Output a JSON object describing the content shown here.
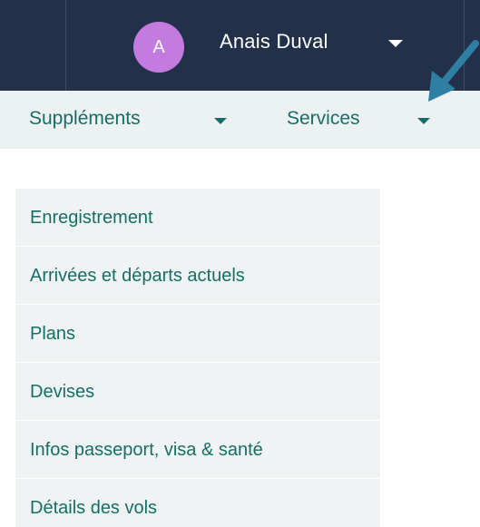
{
  "header": {
    "avatar_initial": "A",
    "user_name": "Anais Duval"
  },
  "nav": {
    "items": [
      {
        "label": "Suppléments"
      },
      {
        "label": "Services"
      }
    ]
  },
  "menu": {
    "items": [
      {
        "label": "Enregistrement"
      },
      {
        "label": "Arrivées et départs actuels"
      },
      {
        "label": "Plans"
      },
      {
        "label": "Devises"
      },
      {
        "label": "Infos passeport, visa & santé"
      },
      {
        "label": "Détails des vols"
      }
    ]
  },
  "colors": {
    "header_bg": "#22304a",
    "avatar_bg": "#c47be0",
    "subnav_bg": "#ecf1f2",
    "link_text": "#176e66",
    "menu_bg": "#eff3f3",
    "annotation_arrow": "#2e7fa3"
  }
}
